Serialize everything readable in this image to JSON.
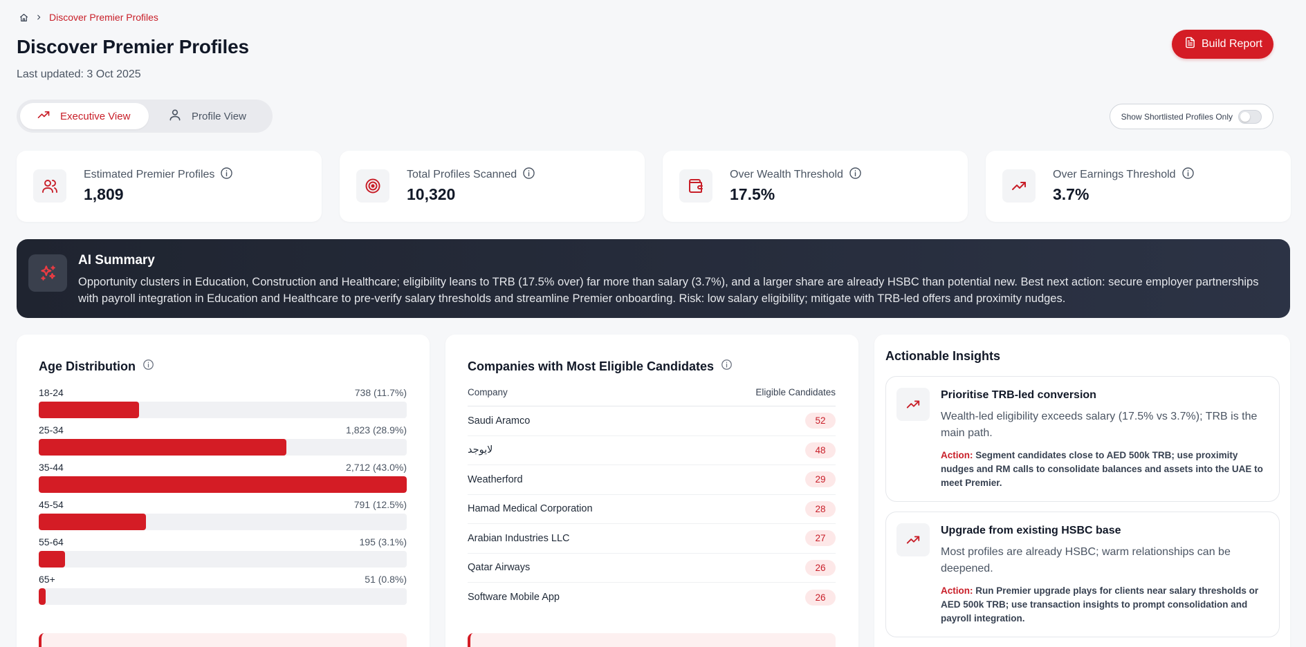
{
  "breadcrumb": {
    "current": "Discover Premier Profiles"
  },
  "header": {
    "title": "Discover Premier Profiles",
    "last_updated": "Last updated: 3 Oct 2025",
    "build_report_label": "Build Report"
  },
  "view_toggle": {
    "executive_label": "Executive View",
    "profile_label": "Profile View",
    "active": "Executive View"
  },
  "shortlist": {
    "label": "Show Shortlisted Profiles Only",
    "enabled": false
  },
  "kpis": [
    {
      "label": "Estimated Premier Profiles",
      "value": "1,809",
      "icon": "users-icon"
    },
    {
      "label": "Total Profiles Scanned",
      "value": "10,320",
      "icon": "target-icon"
    },
    {
      "label": "Over Wealth Threshold",
      "value": "17.5%",
      "icon": "wallet-icon"
    },
    {
      "label": "Over Earnings Threshold",
      "value": "3.7%",
      "icon": "trending-up-icon"
    }
  ],
  "ai_summary": {
    "title": "AI Summary",
    "text": "Opportunity clusters in Education, Construction and Healthcare; eligibility leans to TRB (17.5% over) far more than salary (3.7%), and a larger share are already HSBC than potential new. Best next action: secure employer partnerships with payroll integration in Education and Healthcare to pre-verify salary thresholds and streamline Premier onboarding. Risk: low salary eligibility; mitigate with TRB-led offers and proximity nudges."
  },
  "age_distribution": {
    "title": "Age Distribution",
    "rows": [
      {
        "label": "18-24",
        "count": "738 (11.7%)",
        "value": 738
      },
      {
        "label": "25-34",
        "count": "1,823 (28.9%)",
        "value": 1823
      },
      {
        "label": "35-44",
        "count": "2,712 (43.0%)",
        "value": 2712
      },
      {
        "label": "45-54",
        "count": "791 (12.5%)",
        "value": 791
      },
      {
        "label": "55-64",
        "count": "195 (3.1%)",
        "value": 195
      },
      {
        "label": "65+",
        "count": "51 (0.8%)",
        "value": 51
      }
    ],
    "max": 2712
  },
  "companies": {
    "title": "Companies with Most Eligible Candidates",
    "col_company": "Company",
    "col_candidates": "Eligible Candidates",
    "rows": [
      {
        "name": "Saudi Aramco",
        "count": "52"
      },
      {
        "name": "لايوجد",
        "count": "48"
      },
      {
        "name": "Weatherford",
        "count": "29"
      },
      {
        "name": "Hamad Medical Corporation",
        "count": "28"
      },
      {
        "name": "Arabian Industries LLC",
        "count": "27"
      },
      {
        "name": "Qatar Airways",
        "count": "26"
      },
      {
        "name": "Software Mobile App",
        "count": "26"
      }
    ]
  },
  "insights": {
    "title": "Actionable Insights",
    "action_label": "Action:",
    "cards": [
      {
        "heading": "Prioritise TRB-led conversion",
        "description": "Wealth-led eligibility exceeds salary (17.5% vs 3.7%); TRB is the main path.",
        "action": "Segment candidates close to AED 500k TRB; use proximity nudges and RM calls to consolidate balances and assets into the UAE to meet Premier."
      },
      {
        "heading": "Upgrade from existing HSBC base",
        "description": "Most profiles are already HSBC; warm relationships can be deepened.",
        "action": "Run Premier upgrade plays for clients near salary thresholds or AED 500k TRB; use transaction insights to prompt consolidation and payroll integration."
      }
    ]
  },
  "colors": {
    "accent": "#d41c25",
    "dark_panel": "#252b38"
  }
}
